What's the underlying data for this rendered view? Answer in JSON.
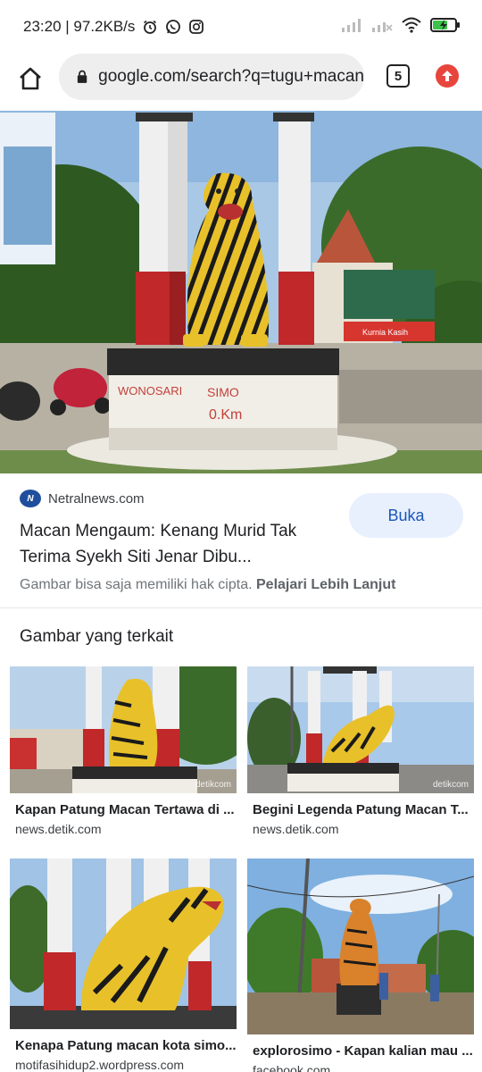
{
  "status_bar": {
    "time_speed": "23:20 | 97.2KB/s",
    "icons": [
      "alarm-icon",
      "whatsapp-icon",
      "instagram-icon",
      "signal-icon",
      "signal-off-icon",
      "wifi-icon",
      "battery-charging-icon"
    ]
  },
  "browser": {
    "url": "google.com/search?q=tugu+macan",
    "tab_count": "5"
  },
  "result": {
    "source": "Netralnews.com",
    "title": "Macan Mengaum: Kenang Murid Tak Terima Syekh Siti Jenar Dibu...",
    "open_label": "Buka",
    "copyright_text": "Gambar bisa saja memiliki hak cipta.",
    "copyright_link": "Pelajari Lebih Lanjut",
    "hero_sign_texts": [
      "WONOSARI",
      "SIMO",
      "0.Km"
    ]
  },
  "related": {
    "heading": "Gambar yang terkait",
    "items": [
      {
        "title": "Kapan Patung Macan Tertawa di ...",
        "source": "news.detik.com",
        "watermark": "detikcom"
      },
      {
        "title": "Begini Legenda Patung Macan T...",
        "source": "news.detik.com",
        "watermark": "detikcom"
      },
      {
        "title": "Kenapa Patung macan kota simo...",
        "source": "motifasihidup2.wordpress.com",
        "watermark": ""
      },
      {
        "title": "explorosimo - Kapan kalian mau ...",
        "source": "facebook.com",
        "watermark": ""
      }
    ]
  },
  "colors": {
    "accent": "#1a56b8",
    "button_bg": "#e8f0fe",
    "update": "#e8453c",
    "tiger_yellow": "#e8c12a",
    "pillar_red": "#c0282a"
  }
}
